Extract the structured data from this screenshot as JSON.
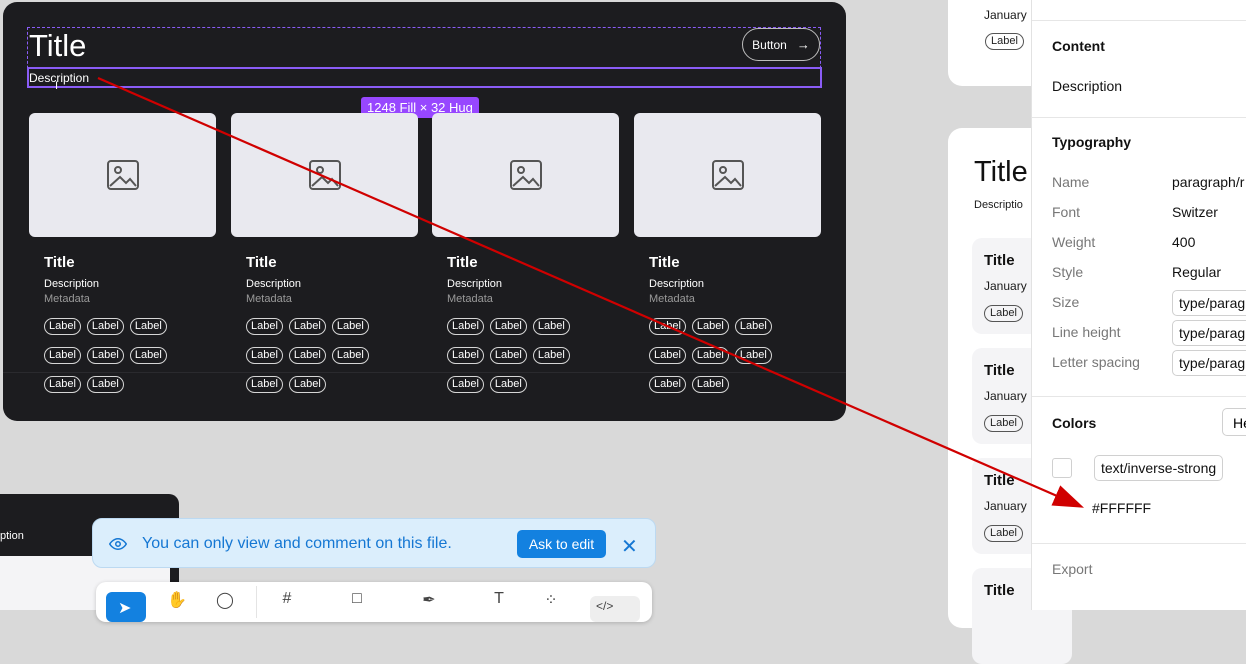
{
  "canvas": {
    "frame": {
      "title": "Title",
      "description": "Description",
      "button_label": "Button",
      "selection_tag": "1248 Fill × 32 Hug"
    },
    "cards": [
      {
        "title": "Title",
        "description": "Description",
        "metadata": "Metadata",
        "labels": [
          "Label",
          "Label",
          "Label",
          "Label",
          "Label",
          "Label",
          "Label",
          "Label"
        ]
      },
      {
        "title": "Title",
        "description": "Description",
        "metadata": "Metadata",
        "labels": [
          "Label",
          "Label",
          "Label",
          "Label",
          "Label",
          "Label",
          "Label",
          "Label"
        ]
      },
      {
        "title": "Title",
        "description": "Description",
        "metadata": "Metadata",
        "labels": [
          "Label",
          "Label",
          "Label",
          "Label",
          "Label",
          "Label",
          "Label",
          "Label"
        ]
      },
      {
        "title": "Title",
        "description": "Description",
        "metadata": "Metadata",
        "labels": [
          "Label",
          "Label",
          "Label",
          "Label",
          "Label",
          "Label",
          "Label",
          "Label"
        ]
      }
    ],
    "secondary_frame_description": "ption"
  },
  "right_preview": {
    "top_card": {
      "date": "January",
      "chip": "Label"
    },
    "main_card": {
      "title": "Title",
      "description": "Descriptio",
      "items": [
        {
          "title": "Title",
          "date": "January",
          "chip": "Label"
        },
        {
          "title": "Title",
          "date": "January",
          "chip": "Label"
        },
        {
          "title": "Title",
          "date": "January",
          "chip": "Label"
        },
        {
          "title": "Title"
        }
      ]
    }
  },
  "inspector": {
    "content_heading": "Content",
    "content_value": "Description",
    "typography_heading": "Typography",
    "rows": [
      {
        "label": "Name",
        "value": "paragraph/r"
      },
      {
        "label": "Font",
        "value": "Switzer"
      },
      {
        "label": "Weight",
        "value": "400"
      },
      {
        "label": "Style",
        "value": "Regular"
      },
      {
        "label": "Size",
        "value": "type/parag"
      },
      {
        "label": "Line height",
        "value": "type/parag"
      },
      {
        "label": "Letter spacing",
        "value": "type/parag"
      }
    ],
    "colors_heading": "Colors",
    "colors_dropdown": "He",
    "color_token": "text/inverse-strong",
    "color_hex": "#FFFFFF",
    "export_heading": "Export"
  },
  "toast": {
    "message": "You can only view and comment on this file.",
    "action_label": "Ask to edit"
  },
  "colors": {
    "selection": "#8a5cf6",
    "tag": "#9747ff",
    "annotation_arrow": "#d00000",
    "toast_accent": "#1381e0"
  }
}
